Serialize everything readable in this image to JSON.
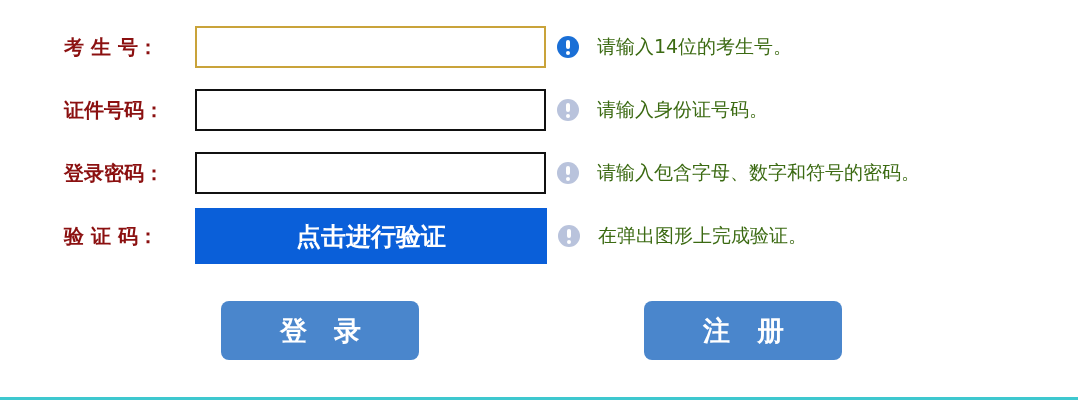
{
  "rows": [
    {
      "label": "考 生 号：",
      "kind": "input",
      "focused": true,
      "hint": "请输入14位的考生号。"
    },
    {
      "label": "证件号码：",
      "kind": "input",
      "focused": false,
      "hint": "请输入身份证号码。"
    },
    {
      "label": "登录密码：",
      "kind": "input",
      "focused": false,
      "hint": "请输入包含字母、数字和符号的密码。"
    },
    {
      "label": "验 证 码：",
      "kind": "captcha",
      "focused": false,
      "button": "点击进行验证",
      "hint": "在弹出图形上完成验证。"
    }
  ],
  "buttons": [
    "登　录",
    "注　册"
  ]
}
